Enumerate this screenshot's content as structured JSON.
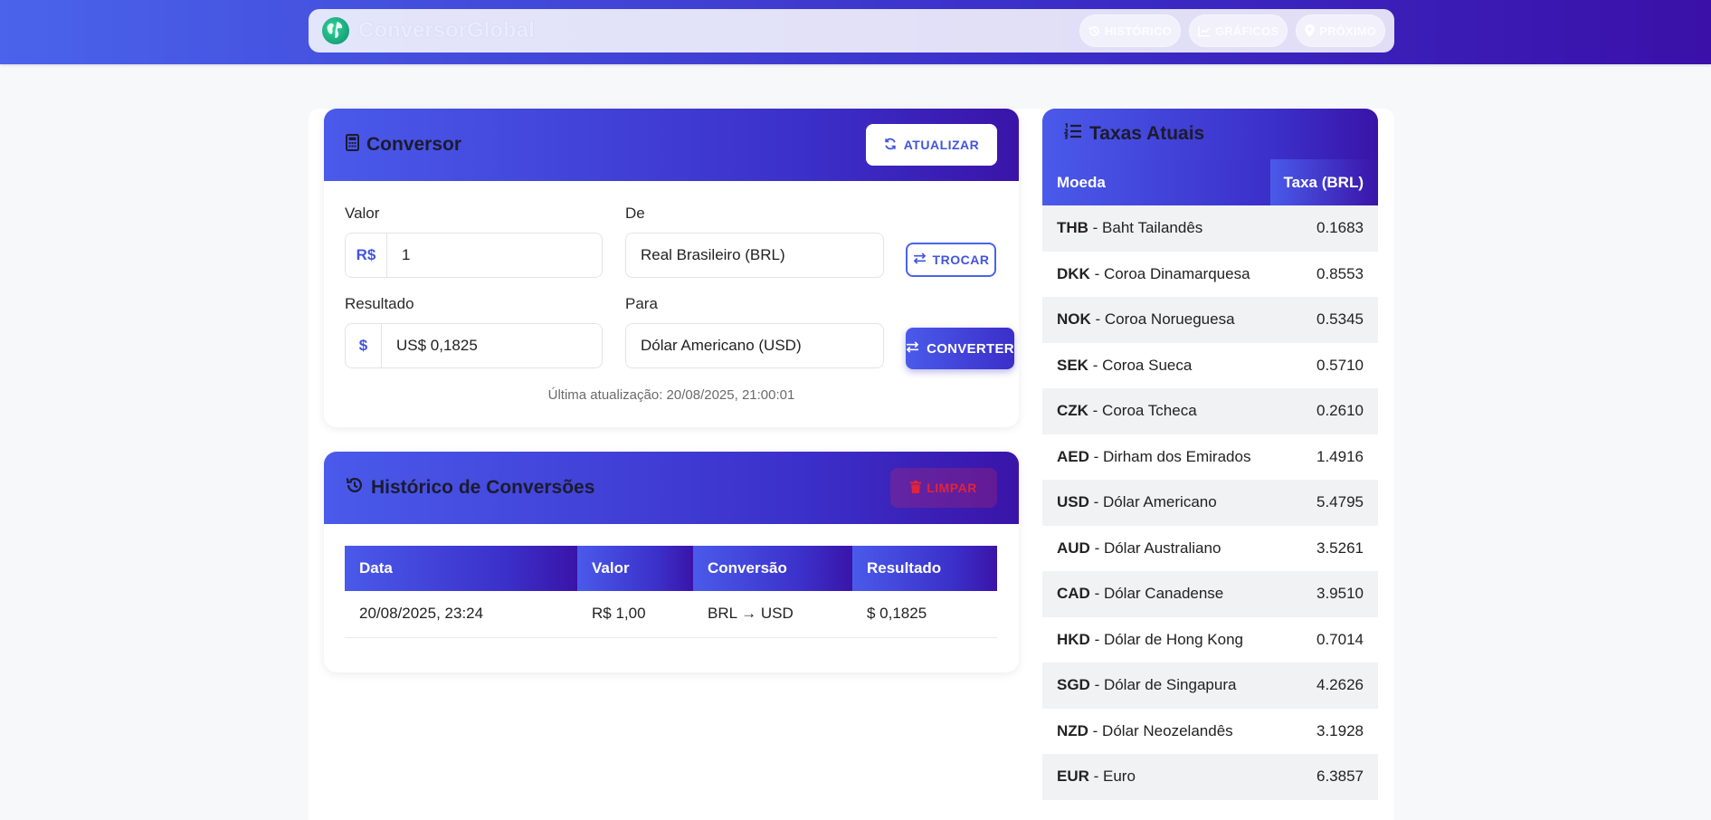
{
  "app": {
    "brand": "ConversorGlobal",
    "nav": [
      {
        "label": "HISTÓRICO",
        "icon": "history-icon"
      },
      {
        "label": "GRÁFICOS",
        "icon": "chart-icon"
      },
      {
        "label": "PRÓXIMO",
        "icon": "location-pin-icon"
      }
    ]
  },
  "converter": {
    "title": "Conversor",
    "refresh_label": "ATUALIZAR",
    "valor_label": "Valor",
    "valor_prefix": "R$",
    "valor_value": "1",
    "de_label": "De",
    "de_value": "Real Brasileiro (BRL)",
    "trocar_label": "TROCAR",
    "resultado_label": "Resultado",
    "resultado_prefix": "$",
    "resultado_value": "US$ 0,1825",
    "para_label": "Para",
    "para_value": "Dólar Americano (USD)",
    "converter_label": "CONVERTER",
    "last_update": "Última atualização: 20/08/2025, 21:00:01"
  },
  "history": {
    "title": "Histórico de Conversões",
    "clear_label": "LIMPAR",
    "columns": [
      "Data",
      "Valor",
      "Conversão",
      "Resultado"
    ],
    "rows": [
      [
        "20/08/2025, 23:24",
        "R$ 1,00",
        "BRL → USD",
        "$ 0,1825"
      ]
    ]
  },
  "rates": {
    "title": "Taxas Atuais",
    "col_currency": "Moeda",
    "col_rate": "Taxa (BRL)",
    "items": [
      {
        "code": "THB",
        "name": " - Baht Tailandês",
        "rate": "0.1683"
      },
      {
        "code": "DKK",
        "name": " - Coroa Dinamarquesa",
        "rate": "0.8553"
      },
      {
        "code": "NOK",
        "name": " - Coroa Norueguesa",
        "rate": "0.5345"
      },
      {
        "code": "SEK",
        "name": " - Coroa Sueca",
        "rate": "0.5710"
      },
      {
        "code": "CZK",
        "name": " - Coroa Tcheca",
        "rate": "0.2610"
      },
      {
        "code": "AED",
        "name": " - Dirham dos Emirados",
        "rate": "1.4916"
      },
      {
        "code": "USD",
        "name": " - Dólar Americano",
        "rate": "5.4795"
      },
      {
        "code": "AUD",
        "name": " - Dólar Australiano",
        "rate": "3.5261"
      },
      {
        "code": "CAD",
        "name": " - Dólar Canadense",
        "rate": "3.9510"
      },
      {
        "code": "HKD",
        "name": " - Dólar de Hong Kong",
        "rate": "0.7014"
      },
      {
        "code": "SGD",
        "name": " - Dólar de Singapura",
        "rate": "4.2626"
      },
      {
        "code": "NZD",
        "name": " - Dólar Neozelandês",
        "rate": "3.1928"
      },
      {
        "code": "EUR",
        "name": " - Euro",
        "rate": "6.3857"
      }
    ]
  }
}
